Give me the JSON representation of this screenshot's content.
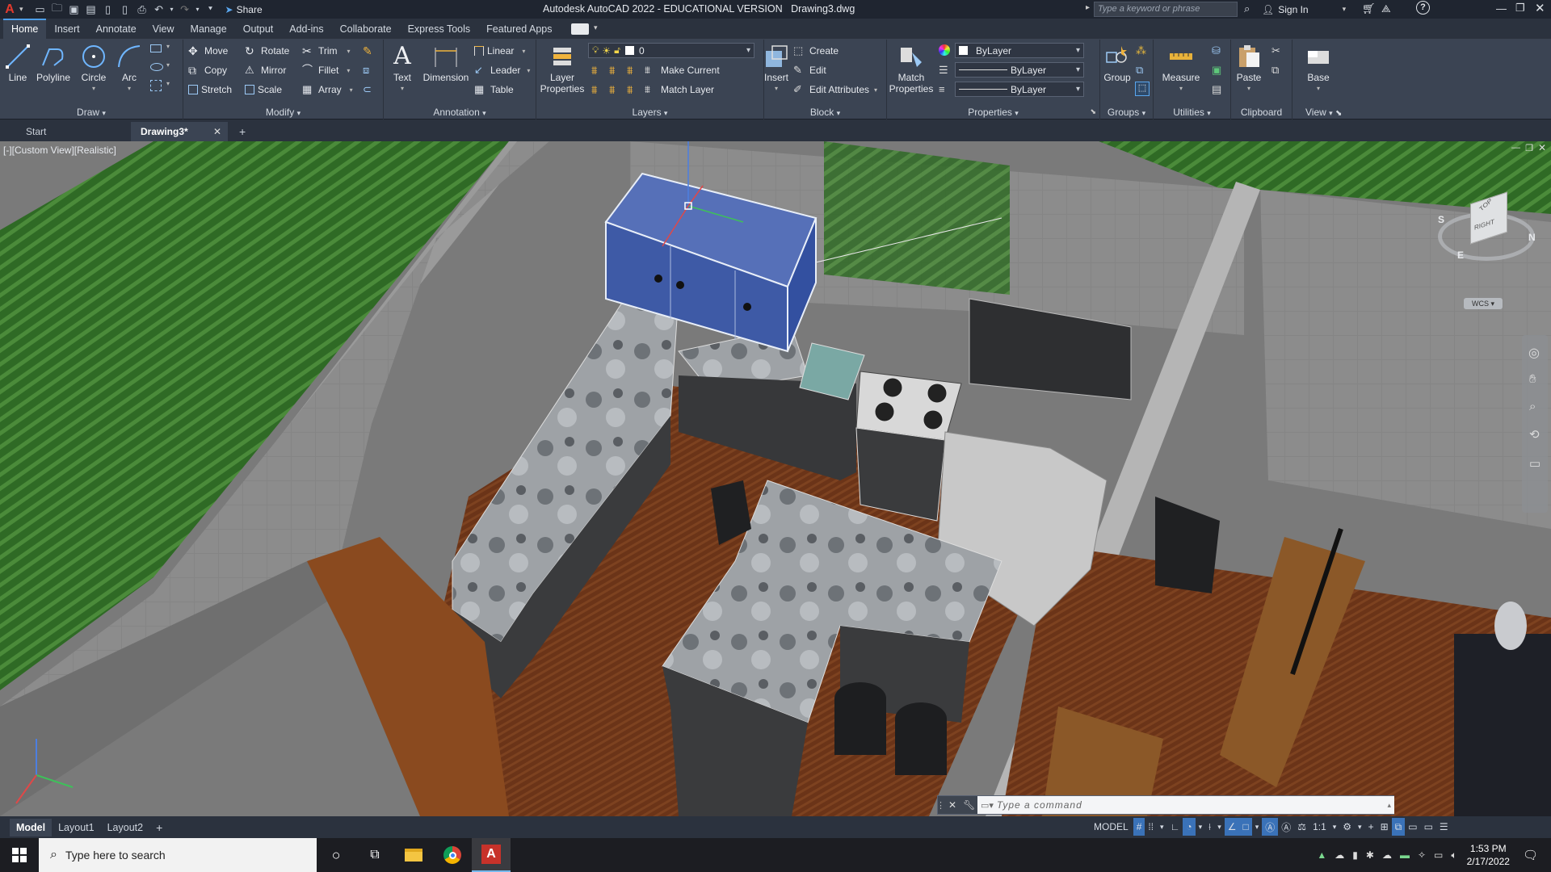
{
  "app": {
    "logo": "A",
    "title": "Autodesk AutoCAD 2022 - EDUCATIONAL VERSION",
    "filename": "Drawing3.dwg",
    "share": "Share",
    "search_placeholder": "Type a keyword or phrase",
    "sign_in": "Sign In"
  },
  "ribbon_tabs": [
    "Home",
    "Insert",
    "Annotate",
    "View",
    "Manage",
    "Output",
    "Add-ins",
    "Collaborate",
    "Express Tools",
    "Featured Apps"
  ],
  "draw": {
    "line": "Line",
    "polyline": "Polyline",
    "circle": "Circle",
    "arc": "Arc",
    "title": "Draw"
  },
  "modify": {
    "move": "Move",
    "rotate": "Rotate",
    "trim": "Trim",
    "copy": "Copy",
    "mirror": "Mirror",
    "fillet": "Fillet",
    "stretch": "Stretch",
    "scale": "Scale",
    "array": "Array",
    "title": "Modify"
  },
  "annotation": {
    "text": "Text",
    "dimension": "Dimension",
    "linear": "Linear",
    "leader": "Leader",
    "table": "Table",
    "title": "Annotation"
  },
  "layers": {
    "layer_properties": "Layer Properties",
    "current_layer": "0",
    "make_current": "Make Current",
    "match_layer": "Match Layer",
    "title": "Layers"
  },
  "block": {
    "insert": "Insert",
    "create": "Create",
    "edit": "Edit",
    "edit_attributes": "Edit Attributes",
    "title": "Block"
  },
  "properties": {
    "match_properties": "Match Properties",
    "color": "ByLayer",
    "linetype": "ByLayer",
    "lineweight": "ByLayer",
    "title": "Properties"
  },
  "groups": {
    "group": "Group",
    "title": "Groups"
  },
  "utilities": {
    "measure": "Measure",
    "title": "Utilities"
  },
  "clipboard": {
    "paste": "Paste",
    "title": "Clipboard"
  },
  "view_panel": {
    "base": "Base",
    "title": "View"
  },
  "doc_tabs": {
    "start": "Start",
    "drawing": "Drawing3*",
    "add": "+"
  },
  "viewport": {
    "label": "[-][Custom View][Realistic]",
    "viewcube_top": "TOP",
    "viewcube_right": "RIGHT",
    "compass_s": "S",
    "compass_e": "E",
    "compass_n": "N",
    "wcs": "WCS",
    "command_placeholder": "Type a command"
  },
  "layout_tabs": [
    "Model",
    "Layout1",
    "Layout2"
  ],
  "status": {
    "model": "MODEL",
    "scale": "1:1"
  },
  "taskbar": {
    "search_placeholder": "Type here to search",
    "time": "1:53 PM",
    "date": "2/17/2022"
  },
  "colors": {
    "accent": "#4d9ee8",
    "ribbon_bg": "#3b4453",
    "selection": "#3e5aa6",
    "grass": "#3b7a2e",
    "floor": "#6b3418"
  }
}
